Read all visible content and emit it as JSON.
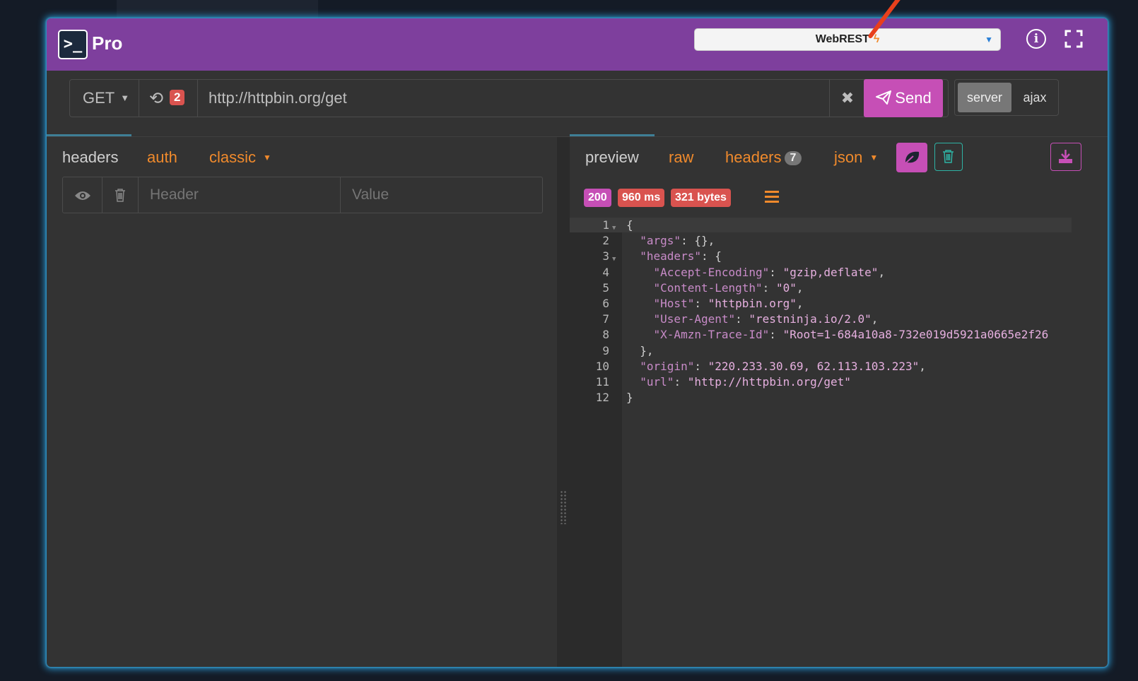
{
  "app": {
    "logo_glyph": ">_",
    "brand": "Pro",
    "api_selector": {
      "value": "WebREST",
      "suffix_icon": "bolt-icon"
    }
  },
  "request": {
    "method": "GET",
    "history_count": "2",
    "url": "http://httpbin.org/get",
    "send_label": "Send",
    "modes": [
      "server",
      "ajax"
    ],
    "active_mode": "server"
  },
  "left_tabs": {
    "headers": "headers",
    "auth": "auth",
    "classic": "classic"
  },
  "header_table": {
    "header_placeholder": "Header",
    "value_placeholder": "Value"
  },
  "right_tabs": {
    "preview": "preview",
    "raw": "raw",
    "headers": "headers",
    "headers_count": "7",
    "format": "json"
  },
  "response_stats": {
    "status": "200",
    "time": "960 ms",
    "size": "321 bytes"
  },
  "colors": {
    "brand_purple": "#7e3f9d",
    "accent_pink": "#c64fb6",
    "accent_orange": "#f08a2c",
    "badge_red": "#d9534f",
    "teal": "#2eb3a4"
  },
  "response_body": {
    "line_numbers": [
      "1",
      "2",
      "3",
      "4",
      "5",
      "6",
      "7",
      "8",
      "9",
      "10",
      "11",
      "12"
    ],
    "lines": [
      "{",
      "  \"args\": {},",
      "  \"headers\": {",
      "    \"Accept-Encoding\": \"gzip,deflate\",",
      "    \"Content-Length\": \"0\",",
      "    \"Host\": \"httpbin.org\",",
      "    \"User-Agent\": \"restninja.io/2.0\",",
      "    \"X-Amzn-Trace-Id\": \"Root=1-684a10a8-732e019d5921a0665e2f26",
      "  },",
      "  \"origin\": \"220.233.30.69, 62.113.103.223\",",
      "  \"url\": \"http://httpbin.org/get\"",
      "}"
    ]
  }
}
